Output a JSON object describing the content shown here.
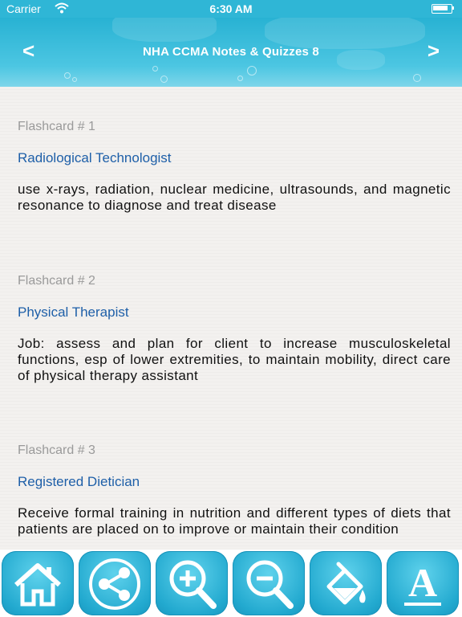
{
  "status_bar": {
    "carrier": "Carrier",
    "time": "6:30 AM",
    "battery_level": 0.9
  },
  "header": {
    "title": "NHA CCMA Notes & Quizzes 8",
    "prev_label": "<",
    "next_label": ">"
  },
  "flashcards": [
    {
      "number_label": "Flashcard # 1",
      "term": "Radiological Technologist",
      "definition": "use x-rays, radiation, nuclear medicine, ultrasounds, and magnetic resonance to diagnose and treat disease"
    },
    {
      "number_label": "Flashcard # 2",
      "term": "Physical Therapist",
      "definition": "Job: assess and plan for client to increase musculoskeletal functions, esp of lower extremities, to maintain mobility, direct care of physical therapy assistant"
    },
    {
      "number_label": "Flashcard # 3",
      "term": "Registered Dietician",
      "definition": "Receive formal training in nutrition and different types of diets that patients are placed on to improve or maintain their condition"
    }
  ],
  "toolbar": {
    "buttons": [
      {
        "icon": "home-icon"
      },
      {
        "icon": "share-icon"
      },
      {
        "icon": "zoom-in-icon"
      },
      {
        "icon": "zoom-out-icon"
      },
      {
        "icon": "paint-bucket-icon"
      },
      {
        "icon": "font-icon",
        "label": "A"
      }
    ]
  },
  "colors": {
    "header_blue": "#2fb6d6",
    "term_blue": "#1e5fa8",
    "number_gray": "#9a9a9a"
  }
}
